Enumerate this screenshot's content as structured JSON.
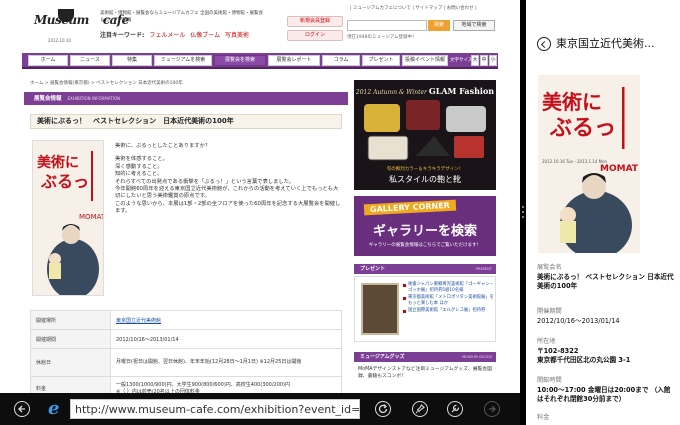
{
  "site": {
    "logo_word": "Museum",
    "logo_word2": "cafe",
    "logo_date": "2012.10.10",
    "tagline": "美術館・博物館・展覧会ならミュージアムカフェ 全国の美術館・博物館・展覧会＆カンファ情報",
    "attention_label": "注目キーワード:",
    "keywords": [
      "フェルメール",
      "仏像ブーム",
      "写真美術"
    ],
    "register_button": "新規会員登録",
    "login_button": "ログイン",
    "toplinks": "| ミュージアムカフェについて | サイトマップ | お問い合わせ |",
    "search_button": "検索",
    "map_button": "地域で検索",
    "search_note": "現在1948のミュージアム登録中！"
  },
  "nav": {
    "tabs": [
      "ホーム",
      "ニュース",
      "特集",
      "ミュージアムを検索",
      "展覧会を検索",
      "展覧会レポート",
      "コラム",
      "プレゼント",
      "投稿イベント情報"
    ],
    "active": "展覧会を検索",
    "font_size_label": "文字サイズ",
    "font_sizes": [
      "大",
      "中",
      "小"
    ]
  },
  "breadcrumb": "ホーム > 展覧会情報(東京都) > ベストセレクション 日本近代美術の100年",
  "exhibition": {
    "section_header": "展覧会情報",
    "section_sub": "EXHIBITION INFORMATION",
    "title": "美術にぶるっ！　ベストセレクション　日本近代美術の100年",
    "paragraphs": [
      "美術に、ぶるっとしたことありますか？",
      "美術を体感すること。\n深く感動すること。\n知的に考えること。\nそれらすべての出発点である衝撃を「ぶるっ！」という言葉で表しました。\n今年開館60周年を迎える東京国立近代美術館が、これからの活動を考えていく上でもっとも大切にしたいと思う美術鑑賞の原点です。\nこのような思いから、本展は1部・2部の全フロアを使った60周年を記念する大展覧会を開催します。"
    ],
    "info": [
      {
        "label": "開催場所",
        "value": "東京国立近代美術館",
        "link": true
      },
      {
        "label": "開催期間",
        "value": "2012/10/16〜2013/01/14"
      },
      {
        "label": "休館日",
        "value": "月曜日(祝日は開館、翌日休館)、年末年始(12月28日〜1月1日) ※12月25日は開館"
      },
      {
        "label": "料金",
        "value": "一般1300(1000/900)円、大学生900(800/600)円、高校生400(300/200)円\n※（ ）内は前売/20名以上の団体料金"
      }
    ]
  },
  "sidebar": {
    "ad1_title_small": "2012 Autumn & Winter",
    "ad1_title_big": "GLAM Fashion",
    "ad1_sub": "旬の鮮烈カラー＆キラキラデザイン！",
    "ad1_main": "私スタイルの鞄と靴",
    "ad2_tag": "GALLERY CORNER",
    "ad2_main": "ギャラリーを検索",
    "ad2_note": "ギャラリーの展覧会情報はこちらでご覧いただけます！",
    "present_header": "プレゼント",
    "present_header_en": "PRESENT",
    "present_items": [
      "後援ジャパン東郷青児美術館「ゴーギャン・ゴッホ展」招待券5組10名様",
      "東京都美術館「メトロポリタン美術館展」をもっと楽しむ本 ほか",
      "国立国際美術館「エルグレコ展」招待券"
    ],
    "goods_header": "ミュージアムグッズ",
    "goods_header_en": "MUSEUM GOODS",
    "goods_text": "MoMAデザインストアなど注目ミュージアムグッズ、展覧会図録、書籍もスコンボ！"
  },
  "snap": {
    "title": "東京国立近代美術...",
    "fields": [
      {
        "label": "展覧会名",
        "value": "美術にぶるっ！ ベストセレクション 日本近代美術の100年"
      },
      {
        "label": "開催期間",
        "value": "2012/10/16〜2013/01/14"
      },
      {
        "label": "所在地",
        "value": "〒102-8322\n東京都千代田区北の丸公園 3-1"
      },
      {
        "label": "開館時間",
        "value": "10:00〜17:00 金曜日は20:00まで （入館はそれぞれ閉館30分前まで）"
      },
      {
        "label": "料金",
        "value": ""
      }
    ]
  },
  "poster": {
    "headline": "美術にぶるっ！",
    "sub": "ベストセレクション 日本近代美術の100年",
    "logo": "MOMAT",
    "dates": "2012.10.16 Tue - 2013.1.14 Mon"
  },
  "browser": {
    "url": "http://www.museum-cafe.com/exhibition?event_id=25482"
  }
}
